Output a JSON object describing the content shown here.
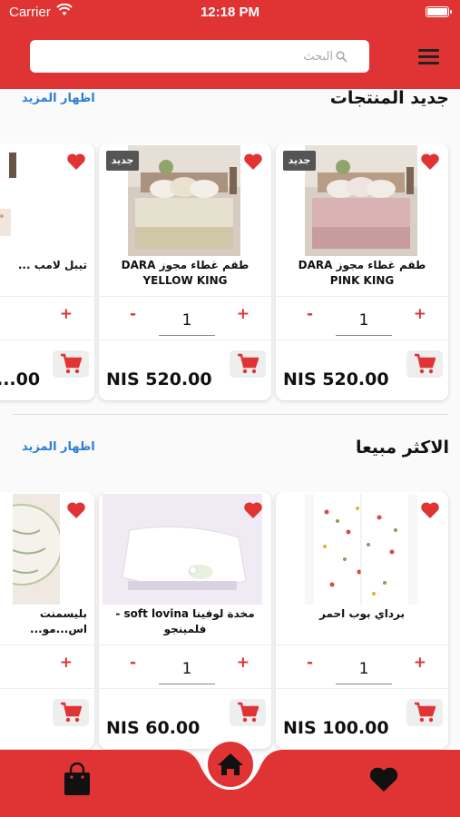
{
  "status_bar": {
    "carrier": "Carrier",
    "time": "12:18 PM"
  },
  "search": {
    "placeholder": "البحث"
  },
  "colors": {
    "brand": "#e03434",
    "link": "#2a7fd4"
  },
  "sections": [
    {
      "title": "جديد المنتجات",
      "show_more": "اظهار المزيد",
      "products": [
        {
          "name": "طقم غطاء مجوز DARA PINK KING",
          "badge": "جديد",
          "qty": "1",
          "price": "NIS 520.00",
          "image": "pink-bedding"
        },
        {
          "name": "طقم غطاء مجوز DARA YELLOW KING",
          "badge": "جديد",
          "qty": "1",
          "price": "NIS 520.00",
          "image": "yellow-bedding"
        },
        {
          "name": "تيبل لامب ...",
          "badge": "",
          "qty": "",
          "price": "...00",
          "image": "lamp"
        }
      ]
    },
    {
      "title": "الاكثر مبيعا",
      "show_more": "اظهار المزيد",
      "products": [
        {
          "name": "برداي بوب احمر",
          "badge": "",
          "qty": "1",
          "price": "NIS 100.00",
          "image": "curtain"
        },
        {
          "name": "مخدة لوفينا soft lovina - فلمينجو",
          "badge": "",
          "qty": "1",
          "price": "NIS 60.00",
          "image": "pillow"
        },
        {
          "name": "بليسمنت اس...مو...",
          "badge": "",
          "qty": "",
          "price": "",
          "image": "placemat"
        }
      ]
    }
  ],
  "bottom_nav": {
    "items": [
      "cart",
      "home",
      "favorites"
    ]
  }
}
